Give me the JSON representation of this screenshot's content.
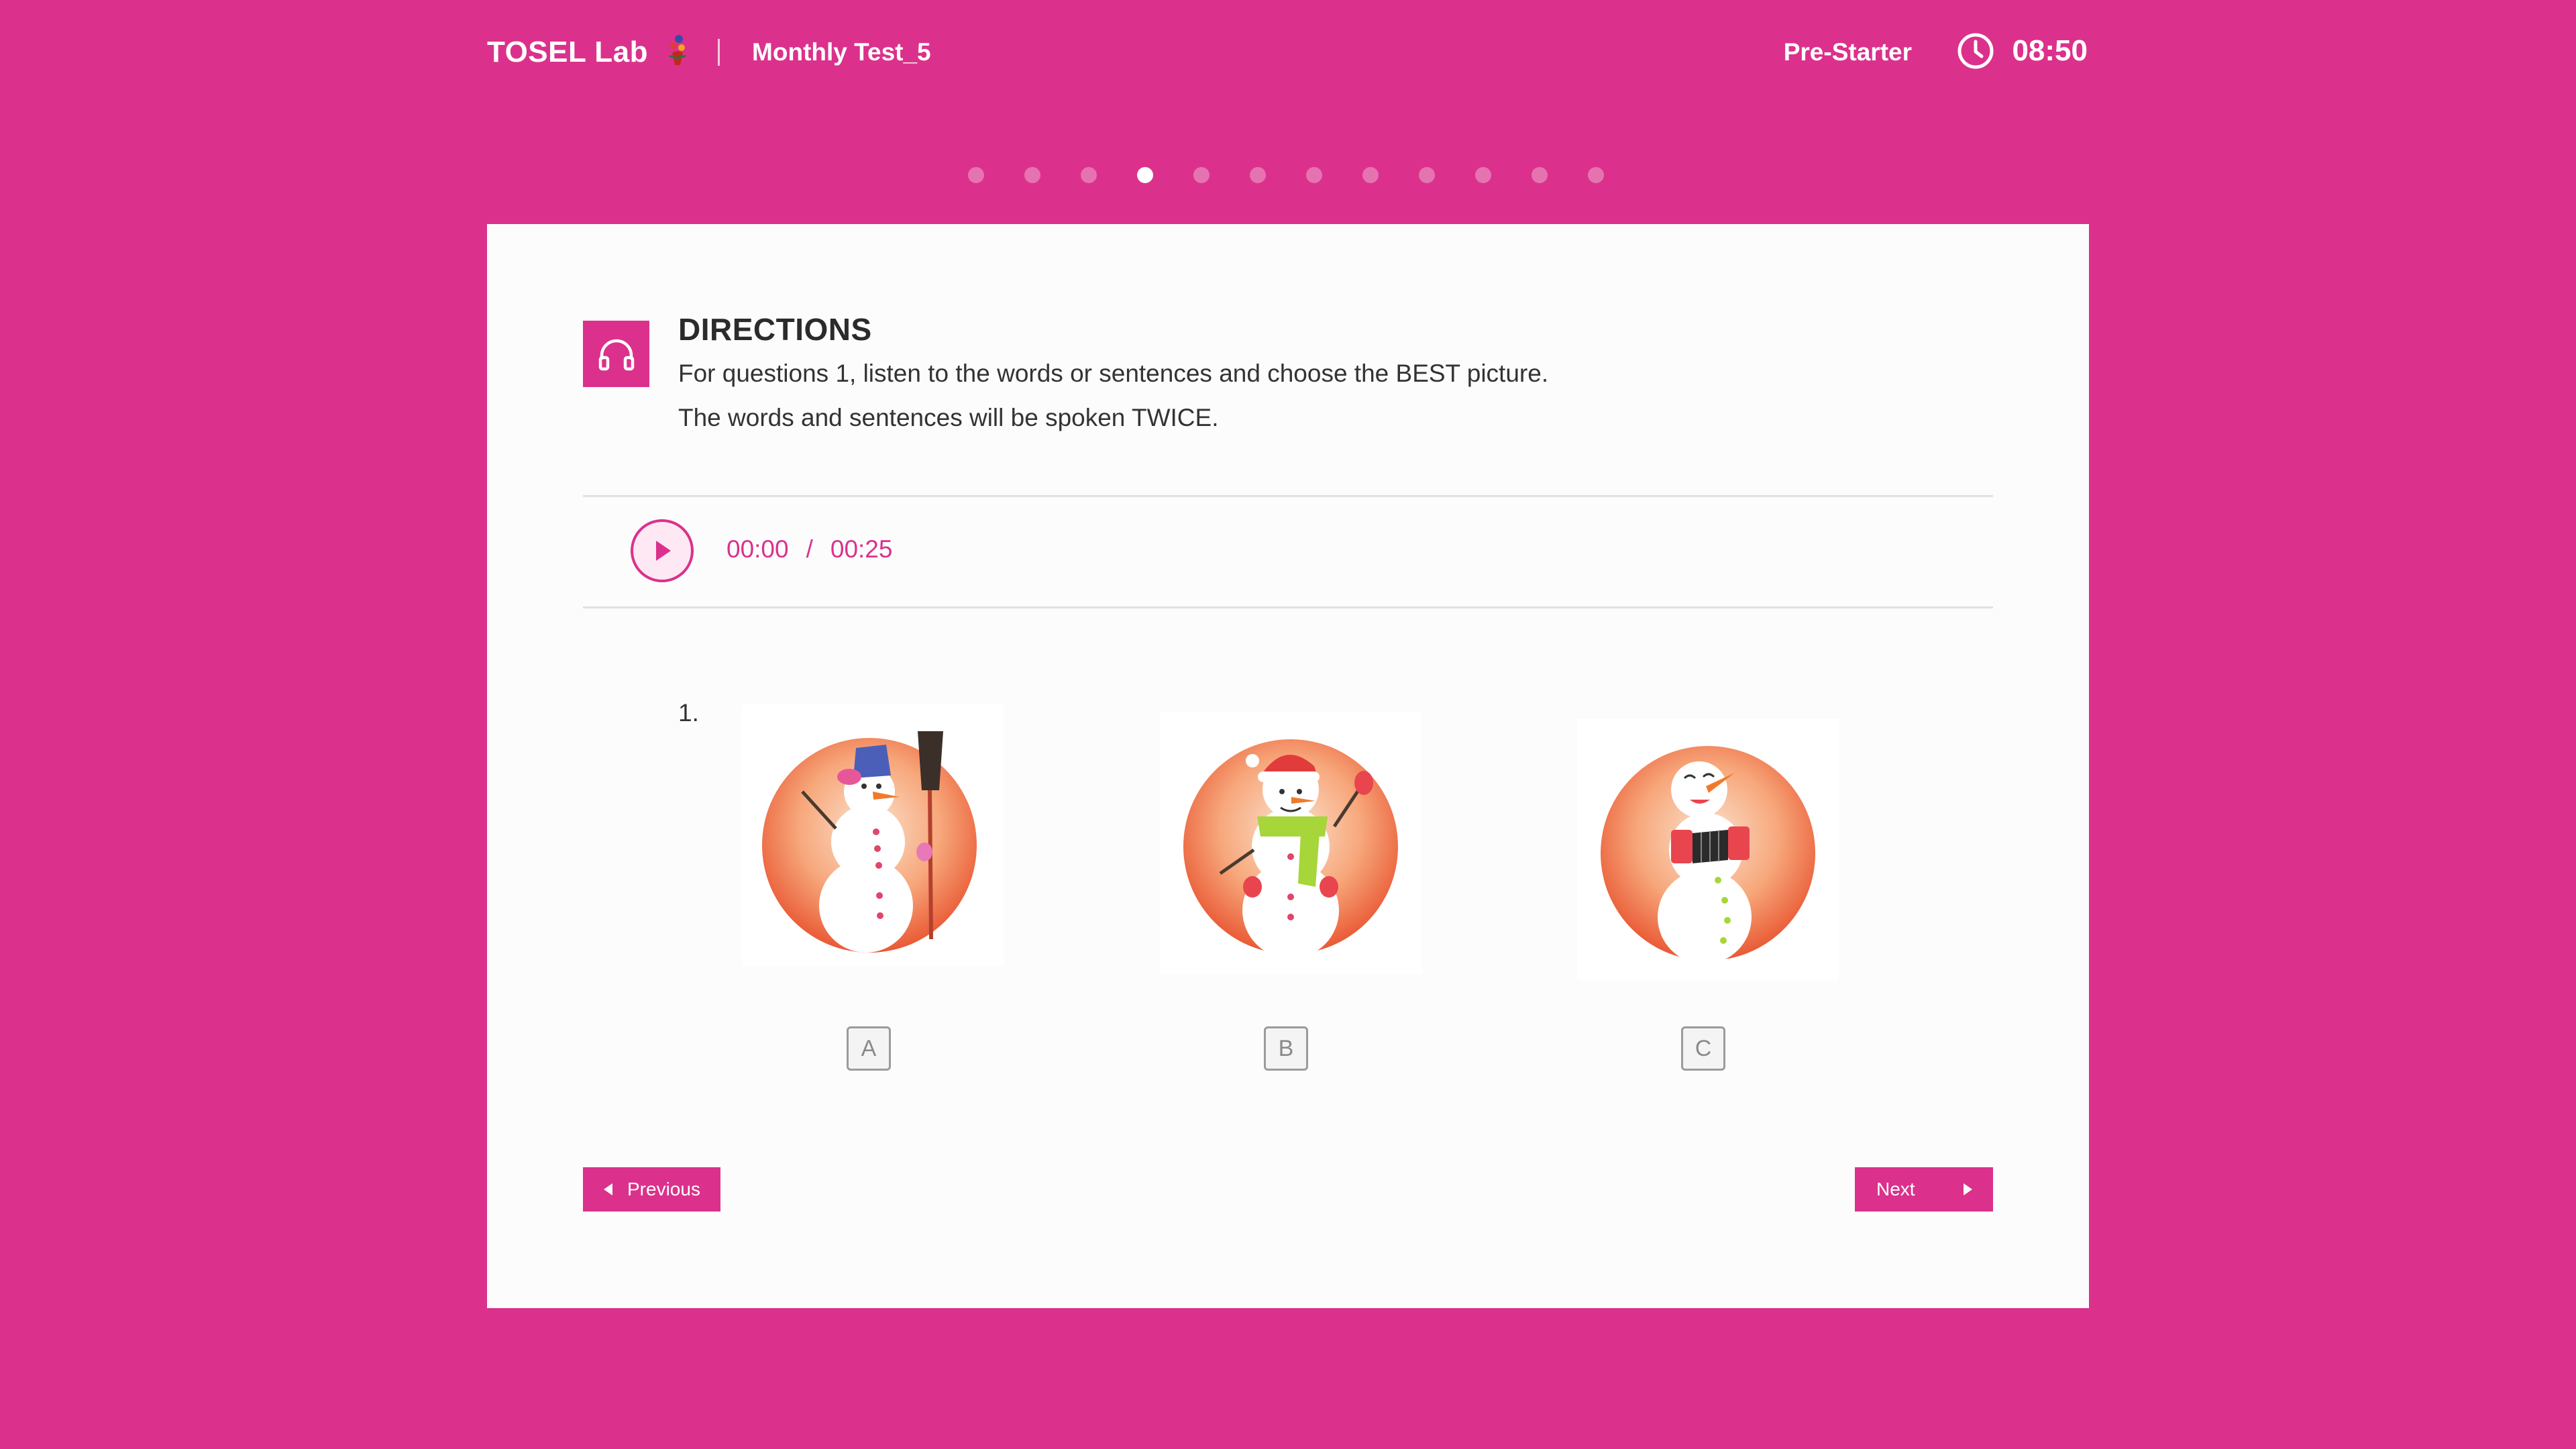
{
  "header": {
    "brand": "TOSEL Lab",
    "test_name": "Monthly Test_5",
    "level": "Pre-Starter",
    "timer": "08:50"
  },
  "progress": {
    "total": 12,
    "current": 4
  },
  "directions": {
    "title": "DIRECTIONS",
    "line1": "For questions 1, listen to the words or sentences and choose the BEST picture.",
    "line2": "The words and sentences will be spoken TWICE."
  },
  "audio": {
    "current": "00:00",
    "separator": "/",
    "duration": "00:25"
  },
  "question": {
    "number": "1.",
    "options": [
      {
        "label": "A",
        "image": "snowman-with-broom-and-blue-bucket-hat"
      },
      {
        "label": "B",
        "image": "snowman-with-santa-hat-and-green-scarf"
      },
      {
        "label": "C",
        "image": "snowman-playing-accordion"
      }
    ]
  },
  "nav": {
    "previous": "Previous",
    "next": "Next"
  },
  "colors": {
    "accent": "#db318c",
    "card": "#fcfcfc",
    "watercolor": "#ef6a45"
  }
}
